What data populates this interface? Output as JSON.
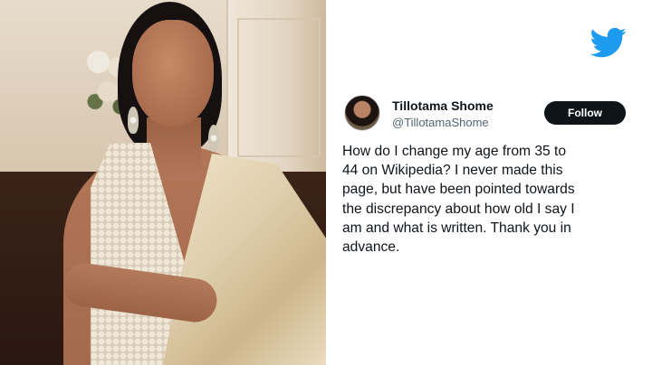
{
  "photo": {
    "description_icon": "portrait-photo"
  },
  "tweet": {
    "platform_icon": "twitter-bird-icon",
    "brand_color": "#1d9bf0",
    "author": {
      "display_name": "Tillotama Shome",
      "handle": "@TillotamaShome"
    },
    "follow_label": "Follow",
    "text_lines": [
      "How do I change my age from 35 to",
      "44 on Wikipedia? I never made this",
      "page, but have been pointed towards",
      "the discrepancy about how old I say I",
      "am and what is written. Thank you in",
      "advance."
    ]
  }
}
